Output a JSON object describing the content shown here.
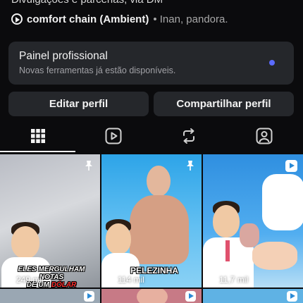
{
  "profile": {
    "bio_clipped": "Divulgações e parcerias, via DM",
    "music": {
      "title": "comfort chain (Ambient)",
      "artists": "• Inan, pandora."
    }
  },
  "pro_panel": {
    "title": "Painel profissional",
    "subtitle": "Novas ferramentas já estão disponíveis."
  },
  "buttons": {
    "edit": "Editar perfil",
    "share": "Compartilhar perfil"
  },
  "tabs": [
    {
      "name": "posts-grid",
      "icon": "grid-icon",
      "active": true
    },
    {
      "name": "reels",
      "icon": "reels-icon",
      "active": false
    },
    {
      "name": "reposts",
      "icon": "repost-icon",
      "active": false
    },
    {
      "name": "tagged",
      "icon": "tagged-person-icon",
      "active": false
    }
  ],
  "posts": [
    {
      "caption_a": "ELES MERGULHAM NOTAS",
      "caption_b": "DE UM",
      "caption_accent": "DÓLAR",
      "views": "249 mil",
      "pinned": true
    },
    {
      "caption": "PELEZINHA",
      "views": "114 mil",
      "pinned": true
    },
    {
      "views": "11,7 mil",
      "pinned": false
    }
  ],
  "colors": {
    "accent_dot": "#5b6bff",
    "panel": "#25272b",
    "background": "#0b0b0d"
  }
}
